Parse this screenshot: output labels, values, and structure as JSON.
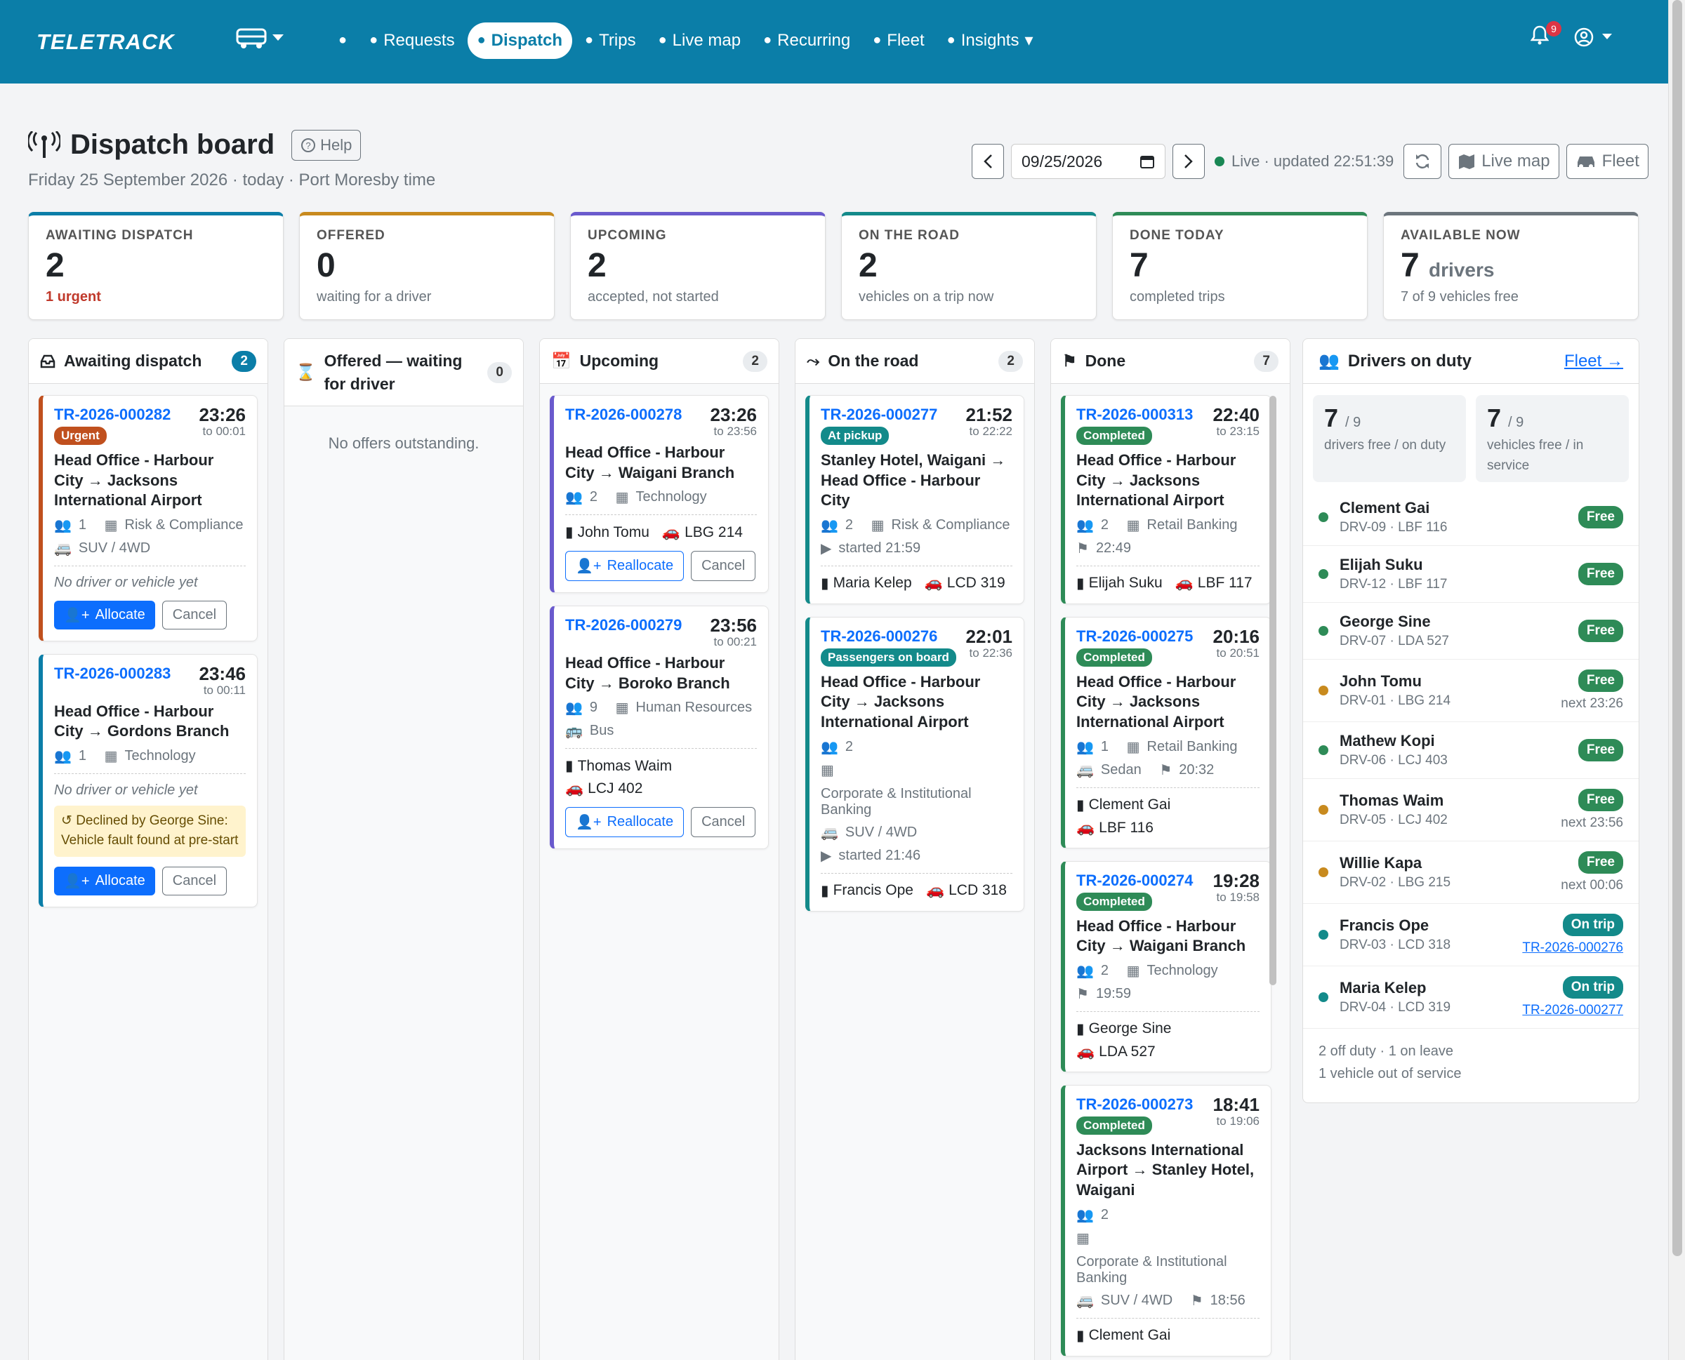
{
  "nav": {
    "brand": "TELETRACK",
    "items": [
      {
        "label": "",
        "icon": "gauge-icon"
      },
      {
        "label": "Requests",
        "icon": "clipboard-icon"
      },
      {
        "label": "Dispatch",
        "icon": "route-icon"
      },
      {
        "label": "Trips",
        "icon": "car-icon"
      },
      {
        "label": "Live map",
        "icon": "map-icon"
      },
      {
        "label": "Recurring",
        "icon": "repeat-icon"
      },
      {
        "label": "Fleet",
        "icon": "id-card-icon"
      },
      {
        "label": "Insights",
        "icon": "pie-chart-icon"
      }
    ],
    "notif_count": "9"
  },
  "header": {
    "title": "Dispatch board",
    "help": "Help",
    "subtitle": "Friday 25 September 2026 · today · Port Moresby time",
    "date": "09/25/2026",
    "live": "Live · updated 22:51:39",
    "livemap": "Live map",
    "fleet": "Fleet"
  },
  "stats": [
    {
      "label": "AWAITING DISPATCH",
      "num": "2",
      "unit": "",
      "sub": "1 urgent",
      "color": "#0b7ea8"
    },
    {
      "label": "OFFERED",
      "num": "0",
      "unit": "",
      "sub": "waiting for a driver",
      "color": "#c88a1e"
    },
    {
      "label": "UPCOMING",
      "num": "2",
      "unit": "",
      "sub": "accepted, not started",
      "color": "#6a5acd"
    },
    {
      "label": "ON THE ROAD",
      "num": "2",
      "unit": "",
      "sub": "vehicles on a trip now",
      "color": "#138a8a"
    },
    {
      "label": "DONE TODAY",
      "num": "7",
      "unit": "",
      "sub": "completed trips",
      "color": "#2e8b57"
    },
    {
      "label": "AVAILABLE NOW",
      "num": "7",
      "unit": "drivers",
      "sub": "7 of 9 vehicles free",
      "color": "#6c757d"
    }
  ],
  "columns": {
    "awaiting": {
      "title": "Awaiting dispatch",
      "count": "2"
    },
    "offered": {
      "title": "Offered — waiting for driver",
      "count": "0",
      "empty": "No offers outstanding."
    },
    "upcoming": {
      "title": "Upcoming",
      "count": "2"
    },
    "road": {
      "title": "On the road",
      "count": "2"
    },
    "done": {
      "title": "Done",
      "count": "7"
    }
  },
  "cards": {
    "a1": {
      "id": "TR-2026-000282",
      "time": "23:26",
      "to": "to 00:01",
      "pill": "Urgent",
      "from": "Head Office - Harbour City",
      "dest": "Jacksons International Airport",
      "pax": "1",
      "dept": "Risk & Compliance",
      "veh": "SUV / 4WD",
      "none": "No driver or vehicle yet",
      "b1": "Allocate",
      "b2": "Cancel"
    },
    "a2": {
      "id": "TR-2026-000283",
      "time": "23:46",
      "to": "to 00:11",
      "from": "Head Office - Harbour City",
      "dest": "Gordons Branch",
      "pax": "1",
      "dept": "Technology",
      "none": "No driver or vehicle yet",
      "warn": "Declined by George Sine: Vehicle fault found at pre-start",
      "b1": "Allocate",
      "b2": "Cancel"
    },
    "u1": {
      "id": "TR-2026-000278",
      "time": "23:26",
      "to": "to 23:56",
      "from": "Head Office - Harbour City",
      "dest": "Waigani Branch",
      "pax": "2",
      "dept": "Technology",
      "driver": "John Tomu",
      "plate": "LBG 214",
      "b1": "Reallocate",
      "b2": "Cancel"
    },
    "u2": {
      "id": "TR-2026-000279",
      "time": "23:56",
      "to": "to 00:21",
      "from": "Head Office - Harbour City",
      "dest": "Boroko Branch",
      "pax": "9",
      "dept": "Human Resources",
      "veh": "Bus",
      "driver": "Thomas Waim",
      "plate": "LCJ 402",
      "b1": "Reallocate",
      "b2": "Cancel"
    },
    "r1": {
      "id": "TR-2026-000277",
      "time": "21:52",
      "to": "to 22:22",
      "pill": "At pickup",
      "from": "Stanley Hotel, Waigani",
      "dest": "Head Office - Harbour City",
      "pax": "2",
      "dept": "Risk & Compliance",
      "started": "started 21:59",
      "driver": "Maria Kelep",
      "plate": "LCD 319"
    },
    "r2": {
      "id": "TR-2026-000276",
      "time": "22:01",
      "to": "to 22:36",
      "pill": "Passengers on board",
      "from": "Head Office - Harbour City",
      "dest": "Jacksons International Airport",
      "pax": "2",
      "dept": "Corporate & Institutional Banking",
      "veh": "SUV / 4WD",
      "started": "started 21:46",
      "driver": "Francis Ope",
      "plate": "LCD 318"
    },
    "d1": {
      "id": "TR-2026-000313",
      "time": "22:40",
      "to": "to 23:15",
      "pill": "Completed",
      "from": "Head Office - Harbour City",
      "dest": "Jacksons International Airport",
      "pax": "2",
      "dept": "Retail Banking",
      "end": "22:49",
      "driver": "Elijah Suku",
      "plate": "LBF 117"
    },
    "d2": {
      "id": "TR-2026-000275",
      "time": "20:16",
      "to": "to 20:51",
      "pill": "Completed",
      "from": "Head Office - Harbour City",
      "dest": "Jacksons International Airport",
      "pax": "1",
      "dept": "Retail Banking",
      "veh": "Sedan",
      "end": "20:32",
      "driver": "Clement Gai",
      "plate": "LBF 116"
    },
    "d3": {
      "id": "TR-2026-000274",
      "time": "19:28",
      "to": "to 19:58",
      "pill": "Completed",
      "from": "Head Office - Harbour City",
      "dest": "Waigani Branch",
      "pax": "2",
      "dept": "Technology",
      "end": "19:59",
      "driver": "George Sine",
      "plate": "LDA 527"
    },
    "d4": {
      "id": "TR-2026-000273",
      "time": "18:41",
      "to": "to 19:06",
      "pill": "Completed",
      "from": "Jacksons International Airport",
      "dest": "Stanley Hotel, Waigani",
      "pax": "2",
      "dept": "Corporate & Institutional Banking",
      "veh": "SUV / 4WD",
      "end": "18:56",
      "driver": "Clement Gai"
    }
  },
  "drivers": {
    "title": "Drivers on duty",
    "fleet": "Fleet",
    "dfree": "7",
    "dtot": "/ 9",
    "dtext": "drivers free / on duty",
    "vfree": "7",
    "vtot": "/ 9",
    "vtext": "vehicles free / in service",
    "list": [
      {
        "name": "Clement Gai",
        "code": "DRV-09 · LBF 116",
        "status": "Free",
        "dot": "#2e8b57",
        "sc": "#2e8b57",
        "next": "",
        "link": ""
      },
      {
        "name": "Elijah Suku",
        "code": "DRV-12 · LBF 117",
        "status": "Free",
        "dot": "#2e8b57",
        "sc": "#2e8b57",
        "next": "",
        "link": ""
      },
      {
        "name": "George Sine",
        "code": "DRV-07 · LDA 527",
        "status": "Free",
        "dot": "#2e8b57",
        "sc": "#2e8b57",
        "next": "",
        "link": ""
      },
      {
        "name": "John Tomu",
        "code": "DRV-01 · LBG 214",
        "status": "Free",
        "dot": "#c88a1e",
        "sc": "#2e8b57",
        "next": "next 23:26",
        "link": ""
      },
      {
        "name": "Mathew Kopi",
        "code": "DRV-06 · LCJ 403",
        "status": "Free",
        "dot": "#2e8b57",
        "sc": "#2e8b57",
        "next": "",
        "link": ""
      },
      {
        "name": "Thomas Waim",
        "code": "DRV-05 · LCJ 402",
        "status": "Free",
        "dot": "#c88a1e",
        "sc": "#2e8b57",
        "next": "next 23:56",
        "link": ""
      },
      {
        "name": "Willie Kapa",
        "code": "DRV-02 · LBG 215",
        "status": "Free",
        "dot": "#c88a1e",
        "sc": "#2e8b57",
        "next": "next 00:06",
        "link": ""
      },
      {
        "name": "Francis Ope",
        "code": "DRV-03 · LCD 318",
        "status": "On trip",
        "dot": "#138a8a",
        "sc": "#138a8a",
        "next": "",
        "link": "TR-2026-000276"
      },
      {
        "name": "Maria Kelep",
        "code": "DRV-04 · LCD 319",
        "status": "On trip",
        "dot": "#138a8a",
        "sc": "#138a8a",
        "next": "",
        "link": "TR-2026-000277"
      }
    ],
    "foot1": "2 off duty · 1 on leave",
    "foot2": "1 vehicle out of service"
  }
}
